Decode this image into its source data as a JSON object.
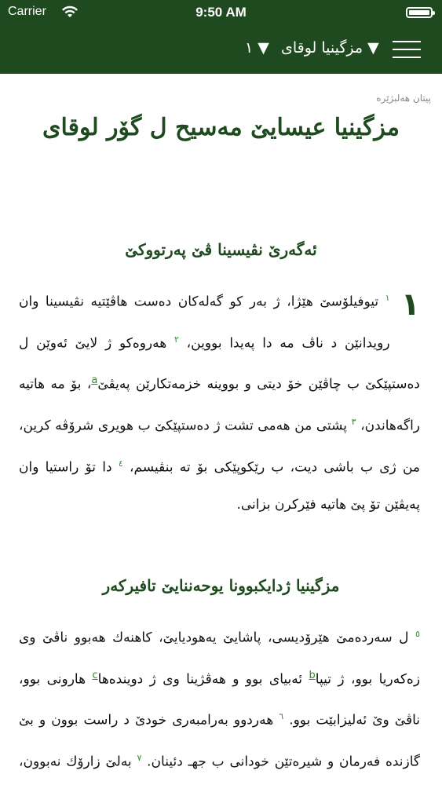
{
  "status": {
    "carrier": "Carrier",
    "time": "9:50 AM"
  },
  "nav": {
    "chapter": "١ ▼",
    "book": "مزگینیا لوقای ▼"
  },
  "content": {
    "section_label": "پیتان هەلبژێرە",
    "title": "مزگینیا عیسایێ مەسیح ل گۆر لوقای",
    "heading1": "ئەگەرێ نڤیسینا ڤێ پەرتووکێ",
    "chapter_number": "١",
    "para1": {
      "v1_num": "١",
      "v1": "تیوفیلۆسێ هێژا، ژ بەر کو گەلەکان دەست هاڤێتیە نڤیسینا وان رویدانێن د ناڤ مە دا پەیدا بووین،",
      "v2_num": "٢",
      "v2": "هەروەکو ژ لایێ ئەوێن ل دەستپێکێ ب چاڤێن خۆ دیتی و بووینە خزمەتکارێن پەیڤێ",
      "fn_a": "a",
      "v2b": "، بۆ مە هاتیە راگەهاندن،",
      "v3_num": "٣",
      "v3": "پشتی من هەمی تشت ژ دەستپێکێ ب هویری شرۆڤە کرین، من ژی ب باشی دیت، ب رێکوپێکی بۆ تە بنڤیسم،",
      "v4_num": "٤",
      "v4": "دا تۆ راستیا وان پەیڤێن تۆ پێ هاتیە فێرکرن بزانی."
    },
    "heading2": "مزگینیا ژدایکبوونا یوحەننایێ تافیرکەر",
    "para2": {
      "v5_num": "٥",
      "v5": "ل سەردەمێ هێرۆدیسی، پاشایێ یەهودیایێ، کاهنەك هەبوو ناڤێ وی زەکەریا بوو، ژ تیپا",
      "fn_b": "b",
      "v5b": "ئەبیای بوو و هەڤژینا وی ژ دویندەها",
      "fn_c": "c",
      "v5c": "هارونی بوو، ناڤێ وێ ئەلیزابێت بوو.",
      "v6_num": "٦",
      "v6": "هەردوو بەرامبەری خودێ د راست بوون و بێ گازندە فەرمان و شیرەتێن خودانی ب جهـ دئینان.",
      "v7_num": "٧",
      "v7": "بەلێ زارۆك نەبوون، چونکی ئەلیزابێت"
    }
  }
}
